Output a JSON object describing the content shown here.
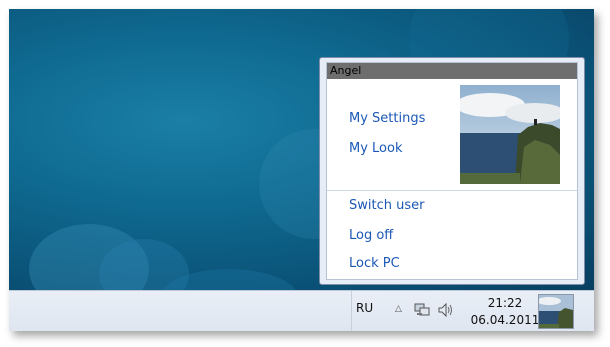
{
  "popup": {
    "user_name": "Angel",
    "links_top": [
      "My Settings",
      "My Look"
    ],
    "links_bottom": [
      "Switch user",
      "Log off",
      "Lock PC"
    ],
    "photo_icon": "user-photo-cliff-landscape"
  },
  "taskbar": {
    "language": "RU",
    "tray_up_icon": "show-hidden-icons",
    "network_icon": "network-icon",
    "volume_icon": "volume-icon",
    "time": "21:22",
    "date": "06.04.2011"
  },
  "colors": {
    "desktop_bg": "#0f6a91",
    "link": "#1b58b6",
    "title_bar": "#6e6e6e",
    "taskbar": "#e4eaf3"
  }
}
